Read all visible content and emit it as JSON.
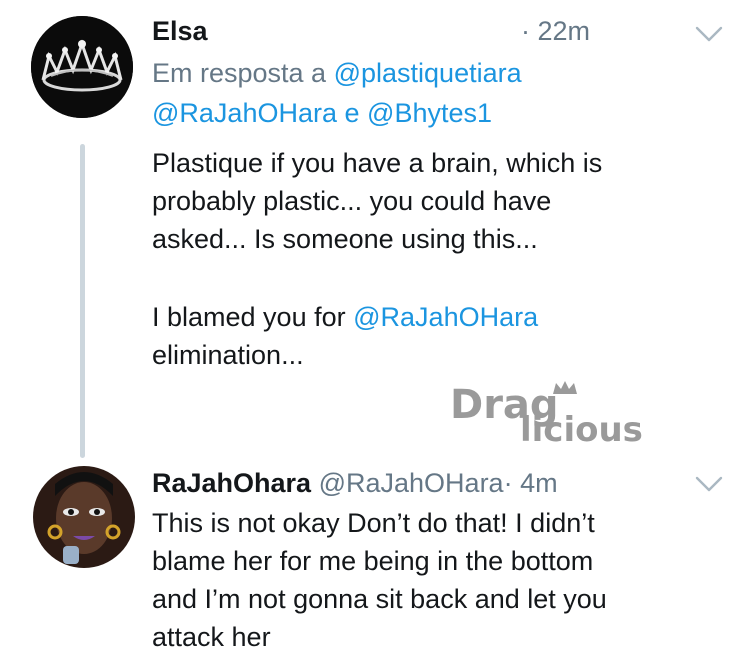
{
  "tweets": [
    {
      "name": "Elsa",
      "time": "22m",
      "time_sep": "·",
      "reply_prefix": "Em resposta a",
      "reply_to_1": "@plastiquetiara",
      "reply_to_2": "@RaJahOHara",
      "reply_conj": "e",
      "reply_to_3": "@Bhytes1",
      "body_lines": [
        "Plastique if you have a brain, which is",
        "probably plastic... you could have",
        "asked... Is someone using this..."
      ],
      "body2_prefix": "I blamed you for",
      "body2_mention": "@RaJahOHara",
      "body2_line2": "elimination...",
      "avatar_icon": "crown-tiara-icon"
    },
    {
      "name": "RaJahOhara",
      "handle": "@RaJahOHara",
      "time_sep": "·",
      "time": "4m",
      "body_lines": [
        "This is not okay Don’t do that! I didn’t",
        "blame her for me being in the bottom",
        "and I’m not gonna sit back and let you",
        "attack her"
      ],
      "avatar_icon": "profile-photo-icon"
    }
  ],
  "watermark": {
    "text_top": "Drag",
    "text_bottom": "licious",
    "icon": "crown-icon"
  },
  "colors": {
    "link": "#1b95e0",
    "muted": "#657786",
    "thread_line": "#ccd6dd",
    "watermark": "#9a9a9a"
  }
}
